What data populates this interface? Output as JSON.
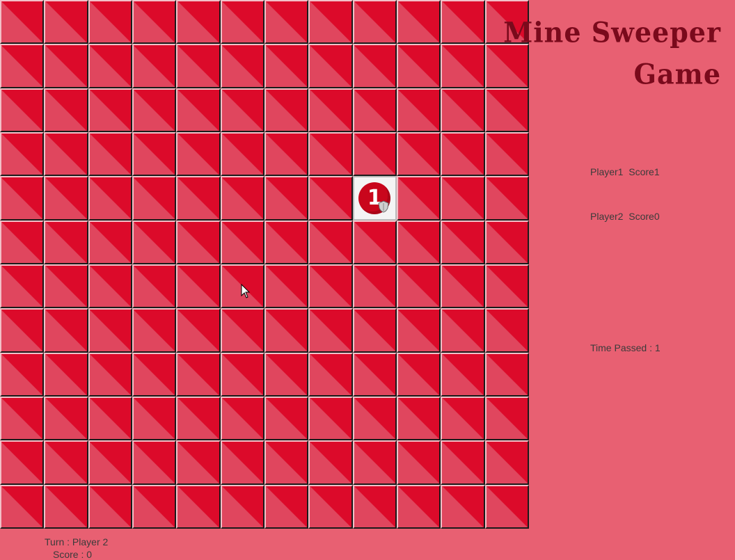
{
  "title": {
    "line1": "Mine Sweeper",
    "line2": "Game"
  },
  "board": {
    "rows": 12,
    "cols": 12,
    "revealed": [
      {
        "row": 4,
        "col": 8,
        "number": "1"
      }
    ]
  },
  "players": [
    {
      "label": "Player1  Score1"
    },
    {
      "label": "Player2  Score0"
    }
  ],
  "time_label": "Time Passed : 1",
  "status": {
    "turn": "Turn : Player 2",
    "score": "Score : 0"
  },
  "colors": {
    "background": "#e86072",
    "tile_dark": "#dc0a2a",
    "tile_light": "#e0465e",
    "title": "#7a0a1c"
  }
}
